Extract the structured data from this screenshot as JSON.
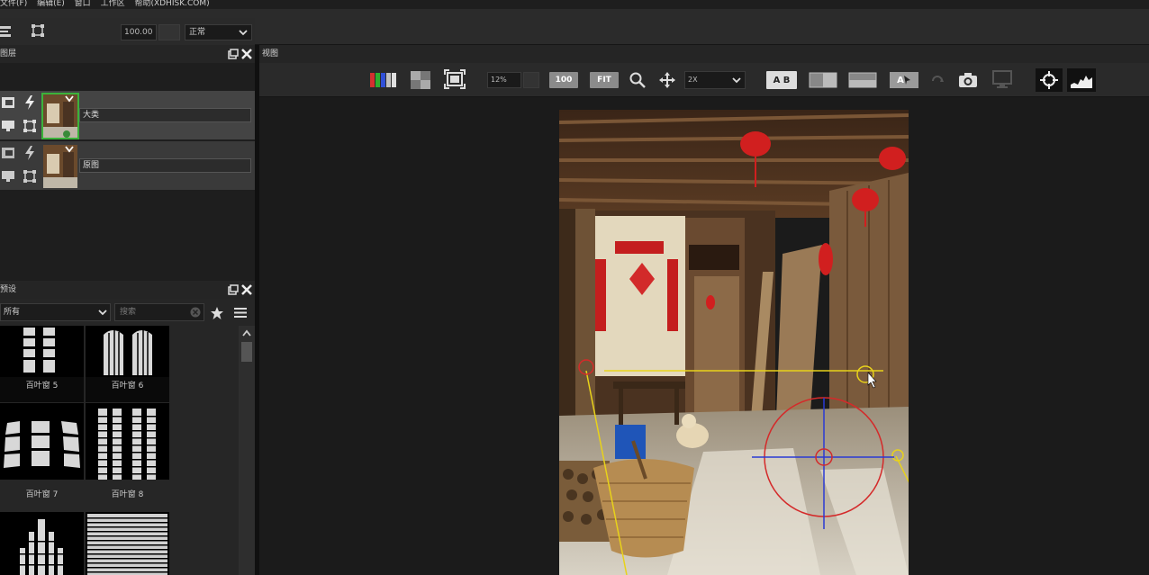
{
  "menubar": {
    "items": [
      "文件(F)",
      "编辑(E)",
      "窗口",
      "工作区",
      "帮助(XDHISK.COM)"
    ]
  },
  "layers_panel": {
    "title": "图层",
    "opacity": "100.00",
    "blend_mode": "正常",
    "layers": [
      {
        "name": "大类",
        "selected": true
      },
      {
        "name": "原图",
        "selected": false
      }
    ]
  },
  "presets_panel": {
    "title": "预设",
    "filter": "所有",
    "search_placeholder": "搜索",
    "presets": [
      "百叶窗 5",
      "百叶窗 6",
      "百叶窗 7",
      "百叶窗 8",
      "",
      ""
    ]
  },
  "view_panel": {
    "title": "视图",
    "zoom_value": "12%",
    "btn_100": "100",
    "btn_fit": "FIT",
    "zoom_level": "2X",
    "ab_label": "A B",
    "a_label": "A"
  },
  "colors": {
    "accent_green": "#3bb33b",
    "guide_yellow": "#e8d21a",
    "guide_red": "#d42a2a",
    "guide_blue": "#2a3ad4"
  }
}
